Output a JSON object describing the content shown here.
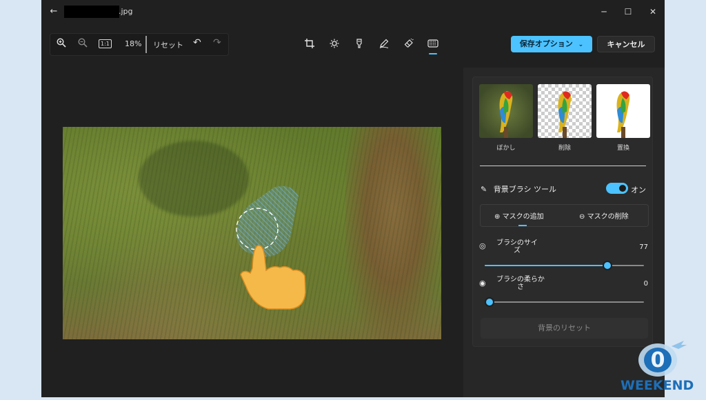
{
  "titlebar": {
    "back_icon": "arrow-left",
    "file_name_suffix": ".jpg",
    "minimize": "─",
    "maximize": "☐",
    "close": "✕"
  },
  "toolbar": {
    "zoom_in_icon": "zoom-in",
    "zoom_out_icon": "zoom-out",
    "actual_size_label": "1:1",
    "zoom_level": "18%",
    "reset_label": "リセット",
    "undo_icon": "undo",
    "redo_icon": "redo"
  },
  "tools": [
    "crop",
    "adjust-brightness",
    "filter",
    "markup",
    "erase",
    "background"
  ],
  "actions": {
    "save_label": "保存オプション",
    "cancel_label": "キャンセル"
  },
  "background_panel": {
    "options": [
      {
        "label": "ぼかし",
        "selected": false
      },
      {
        "label": "削除",
        "selected": false
      },
      {
        "label": "置換",
        "selected": false
      }
    ],
    "brush_tool_label": "背景ブラシ ツール",
    "brush_tool_state": "オン",
    "add_mask_label": "マスクの追加",
    "remove_mask_label": "マスクの削除",
    "brush_size_label_line1": "ブラシのサイ",
    "brush_size_label_line2": "ズ",
    "brush_size_value": "77",
    "brush_size_max": 100,
    "brush_softness_label_line1": "ブラシの柔らか",
    "brush_softness_label_line2": "さ",
    "brush_softness_value": "0",
    "reset_background_label": "背景のリセット"
  },
  "watermark": {
    "text": "WEEKEND",
    "colors": {
      "blue": "#1d6fb8",
      "light": "#8fc3ea"
    }
  },
  "colors": {
    "accent": "#4cc2ff",
    "window_bg": "#202020",
    "panel_bg": "#272727"
  }
}
